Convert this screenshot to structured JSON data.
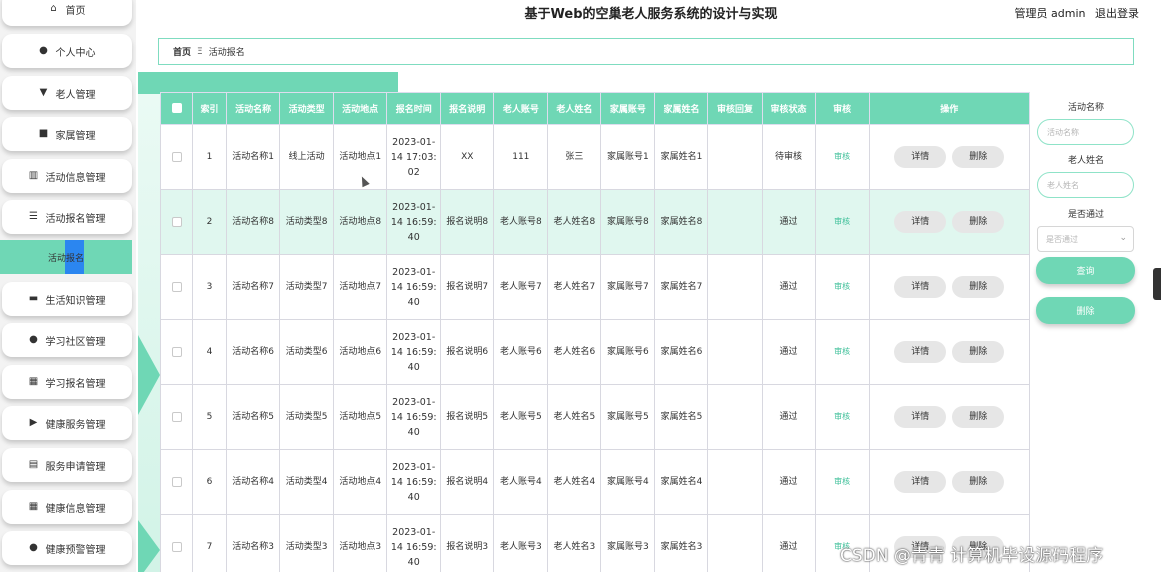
{
  "header": {
    "title": "基于Web的空巢老人服务系统的设计与实现",
    "user": "管理员 admin",
    "logout": "退出登录"
  },
  "sidebar": {
    "items": [
      {
        "label": "首页",
        "icon": "home-icon"
      },
      {
        "label": "个人中心",
        "icon": "person-icon"
      },
      {
        "label": "老人管理",
        "icon": "elder-icon"
      },
      {
        "label": "家属管理",
        "icon": "chat-icon"
      },
      {
        "label": "活动信息管理",
        "icon": "chart-icon"
      },
      {
        "label": "活动报名管理",
        "icon": "list-icon"
      },
      {
        "label": "活动报名",
        "icon": "",
        "active": true
      },
      {
        "label": "生活知识管理",
        "icon": "monitor-icon"
      },
      {
        "label": "学习社区管理",
        "icon": "person-icon"
      },
      {
        "label": "学习报名管理",
        "icon": "grid-icon"
      },
      {
        "label": "健康服务管理",
        "icon": "video-icon"
      },
      {
        "label": "服务申请管理",
        "icon": "doc-icon"
      },
      {
        "label": "健康信息管理",
        "icon": "grid-icon"
      },
      {
        "label": "健康预警管理",
        "icon": "person-icon"
      }
    ]
  },
  "breadcrumb": {
    "home": "首页",
    "separator": "Ξ",
    "current": "活动报名"
  },
  "table": {
    "headers": [
      "索引",
      "活动名称",
      "活动类型",
      "活动地点",
      "报名时间",
      "报名说明",
      "老人账号",
      "老人姓名",
      "家属账号",
      "家属姓名",
      "审核回复",
      "审核状态",
      "审核",
      "操作"
    ],
    "detail_label": "详情",
    "delete_label": "删除",
    "audit_label": "审核",
    "rows": [
      {
        "index": "1",
        "name": "活动名称1",
        "type": "线上活动",
        "place": "活动地点1",
        "time": "2023-01-14 17:03:02",
        "desc": "XX",
        "elder_acct": "111",
        "elder_name": "张三",
        "family_acct": "家属账号1",
        "family_name": "家属姓名1",
        "reply": "",
        "status": "待审核"
      },
      {
        "index": "2",
        "name": "活动名称8",
        "type": "活动类型8",
        "place": "活动地点8",
        "time": "2023-01-14 16:59:40",
        "desc": "报名说明8",
        "elder_acct": "老人账号8",
        "elder_name": "老人姓名8",
        "family_acct": "家属账号8",
        "family_name": "家属姓名8",
        "reply": "",
        "status": "通过"
      },
      {
        "index": "3",
        "name": "活动名称7",
        "type": "活动类型7",
        "place": "活动地点7",
        "time": "2023-01-14 16:59:40",
        "desc": "报名说明7",
        "elder_acct": "老人账号7",
        "elder_name": "老人姓名7",
        "family_acct": "家属账号7",
        "family_name": "家属姓名7",
        "reply": "",
        "status": "通过"
      },
      {
        "index": "4",
        "name": "活动名称6",
        "type": "活动类型6",
        "place": "活动地点6",
        "time": "2023-01-14 16:59:40",
        "desc": "报名说明6",
        "elder_acct": "老人账号6",
        "elder_name": "老人姓名6",
        "family_acct": "家属账号6",
        "family_name": "家属姓名6",
        "reply": "",
        "status": "通过"
      },
      {
        "index": "5",
        "name": "活动名称5",
        "type": "活动类型5",
        "place": "活动地点5",
        "time": "2023-01-14 16:59:40",
        "desc": "报名说明5",
        "elder_acct": "老人账号5",
        "elder_name": "老人姓名5",
        "family_acct": "家属账号5",
        "family_name": "家属姓名5",
        "reply": "",
        "status": "通过"
      },
      {
        "index": "6",
        "name": "活动名称4",
        "type": "活动类型4",
        "place": "活动地点4",
        "time": "2023-01-14 16:59:40",
        "desc": "报名说明4",
        "elder_acct": "老人账号4",
        "elder_name": "老人姓名4",
        "family_acct": "家属账号4",
        "family_name": "家属姓名4",
        "reply": "",
        "status": "通过"
      },
      {
        "index": "7",
        "name": "活动名称3",
        "type": "活动类型3",
        "place": "活动地点3",
        "time": "2023-01-14 16:59:40",
        "desc": "报名说明3",
        "elder_acct": "老人账号3",
        "elder_name": "老人姓名3",
        "family_acct": "家属账号3",
        "family_name": "家属姓名3",
        "reply": "",
        "status": "通过"
      }
    ]
  },
  "search": {
    "activity_name_label": "活动名称",
    "activity_name_placeholder": "活动名称",
    "elder_name_label": "老人姓名",
    "elder_name_placeholder": "老人姓名",
    "passed_label": "是否通过",
    "passed_placeholder": "是否通过",
    "query_button": "查询",
    "delete_button": "删除"
  },
  "watermark": "CSDN @青青  计算机毕设源码程序",
  "colors": {
    "accent": "#6fd7b5",
    "active_marker": "#2b86f0",
    "highlight_row": "#e0f7ef"
  }
}
